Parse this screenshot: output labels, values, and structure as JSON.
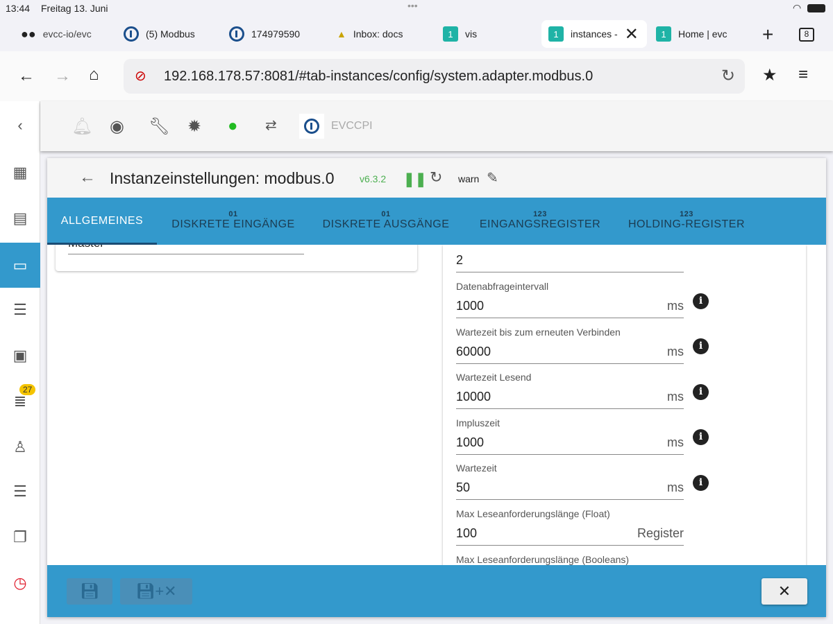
{
  "status": {
    "time": "13:44",
    "date": "Freitag 13. Juni",
    "tab_count": "8"
  },
  "browser_tabs": [
    {
      "label": "evcc-io/evc",
      "icon": "mask-icon"
    },
    {
      "label": "(5) Modbus",
      "icon": "iobroker-icon"
    },
    {
      "label": "174979590",
      "icon": "iobroker-icon"
    },
    {
      "label": "Inbox: docs",
      "icon": "mail-icon"
    },
    {
      "label": "vis",
      "icon": "1"
    },
    {
      "label": "instances -",
      "icon": "1"
    },
    {
      "label": "Home | evc",
      "icon": "1"
    }
  ],
  "url": "192.168.178.57:8081/#tab-instances/config/system.adapter.modbus.0",
  "toolbar": {
    "host_label": "EVCCPI"
  },
  "sidebar": {
    "logs_badge": "27"
  },
  "dialog": {
    "title": "Instanzeinstellungen: modbus.0",
    "version": "v6.3.2",
    "log_level": "warn",
    "tabs": [
      {
        "label": "ALLGEMEINES",
        "num": ""
      },
      {
        "label": "DISKRETE EINGÄNGE",
        "num": "01"
      },
      {
        "label": "DISKRETE AUSGÄNGE",
        "num": "01"
      },
      {
        "label": "EINGANGSREGISTER",
        "num": "123"
      },
      {
        "label": "HOLDING-REGISTER",
        "num": "123"
      }
    ],
    "left_card_label": "Master",
    "first_value": "2",
    "fields": [
      {
        "label": "Datenabfrageintervall",
        "value": "1000",
        "unit": "ms"
      },
      {
        "label": "Wartezeit bis zum erneuten Verbinden",
        "value": "60000",
        "unit": "ms"
      },
      {
        "label": "Wartezeit Lesend",
        "value": "10000",
        "unit": "ms"
      },
      {
        "label": "Impluszeit",
        "value": "1000",
        "unit": "ms"
      },
      {
        "label": "Wartezeit",
        "value": "50",
        "unit": "ms"
      },
      {
        "label": "Max Leseanforderungslänge (Float)",
        "value": "100",
        "unit": "Register"
      }
    ],
    "last_label": "Max Leseanforderungslänge (Booleans)"
  }
}
